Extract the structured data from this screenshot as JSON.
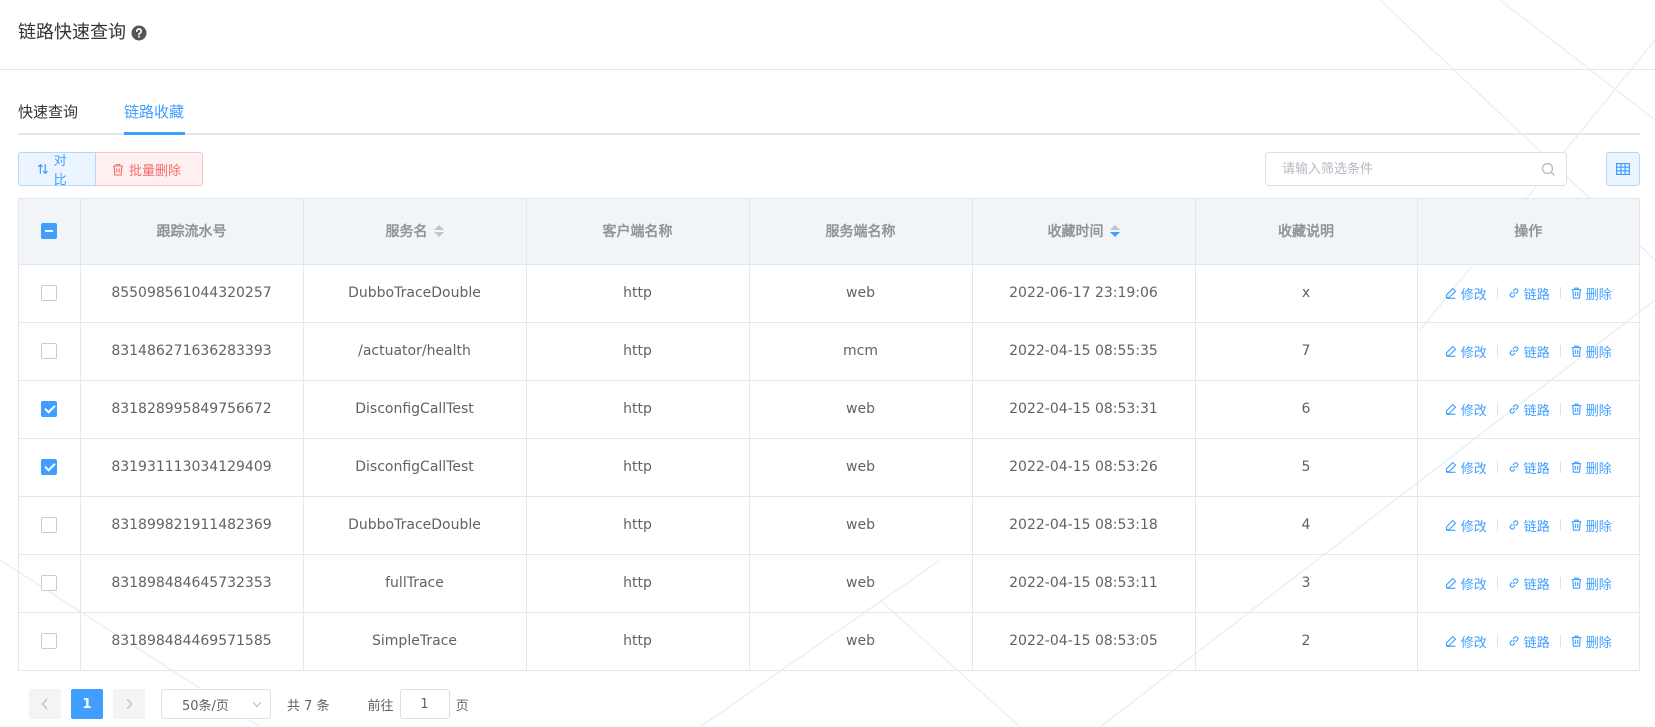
{
  "header": {
    "title": "链路快速查询",
    "help_icon": "question-circle-icon"
  },
  "tabs": [
    {
      "label": "快速查询",
      "active": false
    },
    {
      "label": "链路收藏",
      "active": true
    }
  ],
  "toolbar": {
    "compare_label": "对比",
    "batch_delete_label": "批量删除",
    "search_placeholder": "请输入筛选条件",
    "search_value": ""
  },
  "table": {
    "columns": [
      "跟踪流水号",
      "服务名",
      "客户端名称",
      "服务端名称",
      "收藏时间",
      "收藏说明",
      "操作"
    ],
    "rows": [
      {
        "checked": false,
        "trace_id": "855098561044320257",
        "service": "DubboTraceDouble",
        "client": "http",
        "server": "web",
        "time": "2022-06-17 23:19:06",
        "note": "x"
      },
      {
        "checked": false,
        "trace_id": "831486271636283393",
        "service": "/actuator/health",
        "client": "http",
        "server": "mcm",
        "time": "2022-04-15 08:55:35",
        "note": "7"
      },
      {
        "checked": true,
        "trace_id": "831828995849756672",
        "service": "DisconfigCallTest",
        "client": "http",
        "server": "web",
        "time": "2022-04-15 08:53:31",
        "note": "6"
      },
      {
        "checked": true,
        "trace_id": "831931113034129409",
        "service": "DisconfigCallTest",
        "client": "http",
        "server": "web",
        "time": "2022-04-15 08:53:26",
        "note": "5"
      },
      {
        "checked": false,
        "trace_id": "831899821911482369",
        "service": "DubboTraceDouble",
        "client": "http",
        "server": "web",
        "time": "2022-04-15 08:53:18",
        "note": "4"
      },
      {
        "checked": false,
        "trace_id": "831898484645732353",
        "service": "fullTrace",
        "client": "http",
        "server": "web",
        "time": "2022-04-15 08:53:11",
        "note": "3"
      },
      {
        "checked": false,
        "trace_id": "831898484469571585",
        "service": "SimpleTrace",
        "client": "http",
        "server": "web",
        "time": "2022-04-15 08:53:05",
        "note": "2"
      }
    ],
    "actions": {
      "edit": "修改",
      "link": "链路",
      "delete": "删除"
    }
  },
  "pagination": {
    "current_page": "1",
    "page_size": "50条/页",
    "total": "共 7 条",
    "goto_prefix": "前往",
    "goto_value": "1",
    "goto_suffix": "页"
  },
  "colors": {
    "primary": "#409eff",
    "danger": "#f56c6c",
    "header_bg": "#f2f5f8",
    "border": "#e4e7ed"
  }
}
